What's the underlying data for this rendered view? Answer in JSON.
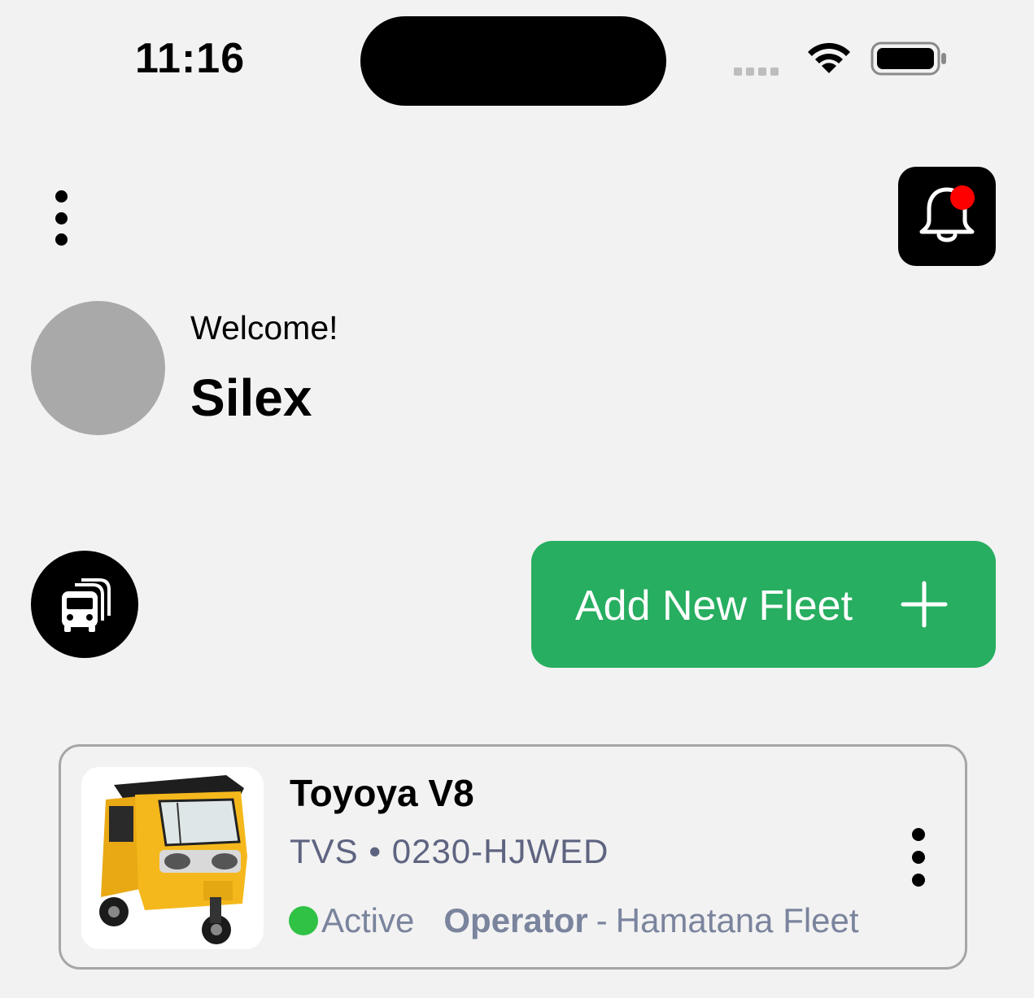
{
  "status_bar": {
    "time": "11:16",
    "icons": [
      "cellular-signal-icon",
      "wifi-icon",
      "battery-icon"
    ]
  },
  "header": {
    "menu_icon": "more-vertical-icon",
    "notification_icon": "bell-icon",
    "notification_has_unread": true
  },
  "profile": {
    "greeting": "Welcome!",
    "name": "Silex"
  },
  "actions": {
    "fleet_icon": "bus-stack-icon",
    "add_fleet_label": "Add New Fleet",
    "add_fleet_icon": "plus-icon"
  },
  "vehicles": [
    {
      "name": "Toyoya V8",
      "make": "TVS",
      "plate": "0230-HJWED",
      "status": "Active",
      "role": "Operator",
      "fleet": "Hamatana Fleet",
      "image": "yellow-auto-rickshaw",
      "options_icon": "more-vertical-icon"
    }
  ],
  "colors": {
    "background": "#f2f2f2",
    "primary_button": "#27ae60",
    "status_active": "#2fc245",
    "notification_dot": "#ff0000",
    "meta_text": "#5e6480"
  }
}
